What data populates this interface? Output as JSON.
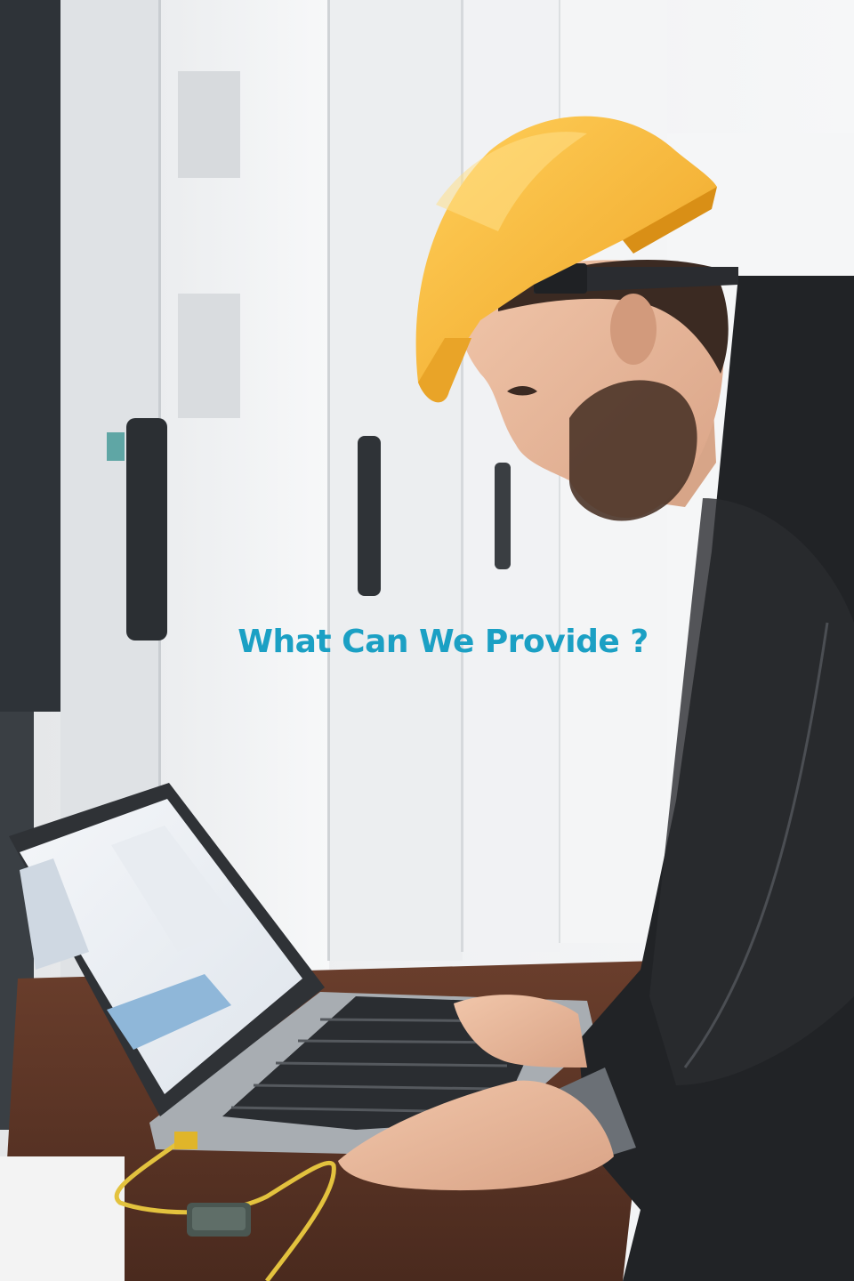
{
  "hero": {
    "headline": "What Can We Provide ?",
    "headline_color": "#1ba0c4",
    "photo_subject": "engineer-in-hard-hat-using-laptop"
  }
}
